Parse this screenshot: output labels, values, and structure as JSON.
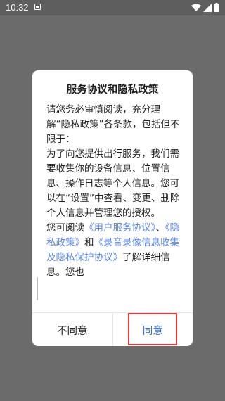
{
  "status_bar": {
    "time": "10:32",
    "notification_icon": "image-notification-icon",
    "wifi_icon": "wifi-icon",
    "signal_icon": "cell-signal-icon",
    "battery_icon": "battery-icon"
  },
  "dialog": {
    "title": "服务协议和隐私政策",
    "body": {
      "p1": "请您务必审慎阅读，充分理解“隐私政策”各条款，包括但不限于：",
      "p2": "为了向您提供出行服务，我们需要收集你的设备信息、位置信息、操作日志等个人信息。您可以在“设置”中查看、变更、删除个人信息并管理您的授权。",
      "p3_prefix": "您可阅读",
      "link_user_agreement": "《用户服务协议》",
      "sep1": "、",
      "link_privacy_policy": "《隐私政策》",
      "sep2": "和",
      "link_recording_protocol": "《录音录像信息收集及隐私保护协议》",
      "p3_suffix": "了解详细信息。您也"
    },
    "buttons": {
      "disagree": "不同意",
      "agree": "同意"
    }
  },
  "colors": {
    "overlay": "#6b6b6b",
    "link": "#5b86e5",
    "agree": "#3d73dd",
    "highlight": "#e53935"
  }
}
